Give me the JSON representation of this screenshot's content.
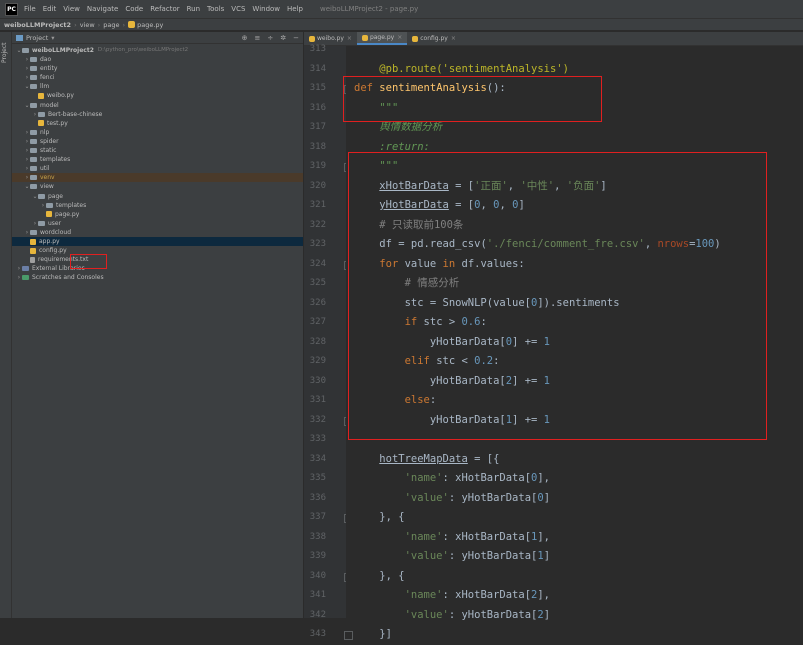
{
  "menubar": {
    "items": [
      "File",
      "Edit",
      "View",
      "Navigate",
      "Code",
      "Refactor",
      "Run",
      "Tools",
      "VCS",
      "Window",
      "Help"
    ],
    "window_title": "weiboLLMProject2 - page.py"
  },
  "breadcrumb": [
    "weiboLLMProject2",
    "view",
    "page",
    "page.py"
  ],
  "project_panel": {
    "title": "Project",
    "strip_label": "Project",
    "tree": [
      {
        "label": "weiboLLMProject2",
        "path": "D:\\python_pro\\weiboLLMProject2",
        "type": "folder",
        "depth": 0,
        "expanded": true,
        "bold": true
      },
      {
        "label": "dao",
        "type": "folder",
        "depth": 1,
        "expanded": false
      },
      {
        "label": "entity",
        "type": "folder",
        "depth": 1,
        "expanded": false
      },
      {
        "label": "fenci",
        "type": "folder",
        "depth": 1,
        "expanded": false
      },
      {
        "label": "llm",
        "type": "folder",
        "depth": 1,
        "expanded": true
      },
      {
        "label": "weibo.py",
        "type": "py",
        "depth": 2
      },
      {
        "label": "model",
        "type": "folder",
        "depth": 1,
        "expanded": true
      },
      {
        "label": "Bert-base-chinese",
        "type": "folder",
        "depth": 2,
        "expanded": false
      },
      {
        "label": "test.py",
        "type": "py",
        "depth": 2
      },
      {
        "label": "nlp",
        "type": "folder",
        "depth": 1,
        "expanded": false
      },
      {
        "label": "spider",
        "type": "folder",
        "depth": 1,
        "expanded": false
      },
      {
        "label": "static",
        "type": "folder",
        "depth": 1,
        "expanded": false
      },
      {
        "label": "templates",
        "type": "folder",
        "depth": 1,
        "expanded": false
      },
      {
        "label": "util",
        "type": "folder",
        "depth": 1,
        "expanded": false
      },
      {
        "label": "venv",
        "type": "folder",
        "depth": 1,
        "expanded": false,
        "venv": true
      },
      {
        "label": "view",
        "type": "folder",
        "depth": 1,
        "expanded": true
      },
      {
        "label": "page",
        "type": "folder",
        "depth": 2,
        "expanded": true
      },
      {
        "label": "templates",
        "type": "folder",
        "depth": 3,
        "expanded": false
      },
      {
        "label": "page.py",
        "type": "py",
        "depth": 3,
        "highlight": true
      },
      {
        "label": "user",
        "type": "folder",
        "depth": 2,
        "expanded": false
      },
      {
        "label": "wordcloud",
        "type": "folder",
        "depth": 1,
        "expanded": false
      },
      {
        "label": "app.py",
        "type": "py",
        "depth": 1,
        "selected": true
      },
      {
        "label": "config.py",
        "type": "py",
        "depth": 1
      },
      {
        "label": "requirements.txt",
        "type": "txt",
        "depth": 1
      },
      {
        "label": "External Libraries",
        "type": "libs",
        "depth": 0,
        "expanded": false
      },
      {
        "label": "Scratches and Consoles",
        "type": "scratch",
        "depth": 0,
        "expanded": false
      }
    ]
  },
  "editor_tabs": [
    {
      "label": "weibo.py",
      "active": false
    },
    {
      "label": "page.py",
      "active": true
    },
    {
      "label": "config.py",
      "active": false
    }
  ],
  "code": {
    "line_numbers": [
      "313",
      "314",
      "315",
      "316",
      "317",
      "318",
      "319",
      "320",
      "321",
      "322",
      "323",
      "324",
      "325",
      "326",
      "327",
      "328",
      "329",
      "330",
      "331",
      "332",
      "333",
      "334",
      "335",
      "336",
      "337",
      "338",
      "339",
      "340",
      "341",
      "342",
      "343"
    ],
    "lines": [
      [],
      [
        {
          "t": "    "
        },
        {
          "t": "@pb.route('sentimentAnalysis')",
          "c": "dec"
        }
      ],
      [
        {
          "t": "def ",
          "c": "kw"
        },
        {
          "t": "sentimentAnalysis",
          "c": "fn"
        },
        {
          "t": "():",
          "c": "var"
        }
      ],
      [
        {
          "t": "    "
        },
        {
          "t": "\"\"\"",
          "c": "doc"
        }
      ],
      [
        {
          "t": "    "
        },
        {
          "t": "舆情数据分析",
          "c": "doc"
        }
      ],
      [
        {
          "t": "    "
        },
        {
          "t": ":return:",
          "c": "doc"
        }
      ],
      [
        {
          "t": "    "
        },
        {
          "t": "\"\"\"",
          "c": "doc"
        }
      ],
      [
        {
          "t": "    "
        },
        {
          "t": "xHotBarData",
          "c": "uvar"
        },
        {
          "t": " = [",
          "c": "var"
        },
        {
          "t": "'正面'",
          "c": "str"
        },
        {
          "t": ", ",
          "c": "var"
        },
        {
          "t": "'中性'",
          "c": "str"
        },
        {
          "t": ", ",
          "c": "var"
        },
        {
          "t": "'负面'",
          "c": "str"
        },
        {
          "t": "]",
          "c": "var"
        }
      ],
      [
        {
          "t": "    "
        },
        {
          "t": "yHotBarData",
          "c": "uvar"
        },
        {
          "t": " = [",
          "c": "var"
        },
        {
          "t": "0",
          "c": "num"
        },
        {
          "t": ", ",
          "c": "var"
        },
        {
          "t": "0",
          "c": "num"
        },
        {
          "t": ", ",
          "c": "var"
        },
        {
          "t": "0",
          "c": "num"
        },
        {
          "t": "]",
          "c": "var"
        }
      ],
      [
        {
          "t": "    "
        },
        {
          "t": "# 只读取前100条",
          "c": "cmt"
        }
      ],
      [
        {
          "t": "    "
        },
        {
          "t": "df = pd.read_csv(",
          "c": "var"
        },
        {
          "t": "'./fenci/comment_fre.csv'",
          "c": "str"
        },
        {
          "t": ", ",
          "c": "var"
        },
        {
          "t": "nrows",
          "c": "param"
        },
        {
          "t": "=",
          "c": "var"
        },
        {
          "t": "100",
          "c": "num"
        },
        {
          "t": ")",
          "c": "var"
        }
      ],
      [
        {
          "t": "    "
        },
        {
          "t": "for ",
          "c": "kw"
        },
        {
          "t": "value ",
          "c": "var"
        },
        {
          "t": "in ",
          "c": "kw"
        },
        {
          "t": "df.values:",
          "c": "var"
        }
      ],
      [
        {
          "t": "        "
        },
        {
          "t": "# 情感分析",
          "c": "cmt"
        }
      ],
      [
        {
          "t": "        "
        },
        {
          "t": "stc = SnowNLP(value[",
          "c": "var"
        },
        {
          "t": "0",
          "c": "num"
        },
        {
          "t": "]).sentiments",
          "c": "var"
        }
      ],
      [
        {
          "t": "        "
        },
        {
          "t": "if ",
          "c": "kw"
        },
        {
          "t": "stc > ",
          "c": "var"
        },
        {
          "t": "0.6",
          "c": "num"
        },
        {
          "t": ":",
          "c": "var"
        }
      ],
      [
        {
          "t": "            "
        },
        {
          "t": "yHotBarData[",
          "c": "var"
        },
        {
          "t": "0",
          "c": "num"
        },
        {
          "t": "] += ",
          "c": "var"
        },
        {
          "t": "1",
          "c": "num"
        }
      ],
      [
        {
          "t": "        "
        },
        {
          "t": "elif ",
          "c": "kw"
        },
        {
          "t": "stc < ",
          "c": "var"
        },
        {
          "t": "0.2",
          "c": "num"
        },
        {
          "t": ":",
          "c": "var"
        }
      ],
      [
        {
          "t": "            "
        },
        {
          "t": "yHotBarData[",
          "c": "var"
        },
        {
          "t": "2",
          "c": "num"
        },
        {
          "t": "] += ",
          "c": "var"
        },
        {
          "t": "1",
          "c": "num"
        }
      ],
      [
        {
          "t": "        "
        },
        {
          "t": "else",
          "c": "kw"
        },
        {
          "t": ":",
          "c": "var"
        }
      ],
      [
        {
          "t": "            "
        },
        {
          "t": "yHotBarData[",
          "c": "var"
        },
        {
          "t": "1",
          "c": "num"
        },
        {
          "t": "] += ",
          "c": "var"
        },
        {
          "t": "1",
          "c": "num"
        }
      ],
      [],
      [
        {
          "t": "    "
        },
        {
          "t": "hotTreeMapData",
          "c": "uvar"
        },
        {
          "t": " = [{",
          "c": "var"
        }
      ],
      [
        {
          "t": "        "
        },
        {
          "t": "'name'",
          "c": "str"
        },
        {
          "t": ": xHotBarData[",
          "c": "var"
        },
        {
          "t": "0",
          "c": "num"
        },
        {
          "t": "],",
          "c": "var"
        }
      ],
      [
        {
          "t": "        "
        },
        {
          "t": "'value'",
          "c": "str"
        },
        {
          "t": ": yHotBarData[",
          "c": "var"
        },
        {
          "t": "0",
          "c": "num"
        },
        {
          "t": "]",
          "c": "var"
        }
      ],
      [
        {
          "t": "    "
        },
        {
          "t": "}, {",
          "c": "var"
        }
      ],
      [
        {
          "t": "        "
        },
        {
          "t": "'name'",
          "c": "str"
        },
        {
          "t": ": xHotBarData[",
          "c": "var"
        },
        {
          "t": "1",
          "c": "num"
        },
        {
          "t": "],",
          "c": "var"
        }
      ],
      [
        {
          "t": "        "
        },
        {
          "t": "'value'",
          "c": "str"
        },
        {
          "t": ": yHotBarData[",
          "c": "var"
        },
        {
          "t": "1",
          "c": "num"
        },
        {
          "t": "]",
          "c": "var"
        }
      ],
      [
        {
          "t": "    "
        },
        {
          "t": "}, {",
          "c": "var"
        }
      ],
      [
        {
          "t": "        "
        },
        {
          "t": "'name'",
          "c": "str"
        },
        {
          "t": ": xHotBarData[",
          "c": "var"
        },
        {
          "t": "2",
          "c": "num"
        },
        {
          "t": "],",
          "c": "var"
        }
      ],
      [
        {
          "t": "        "
        },
        {
          "t": "'value'",
          "c": "str"
        },
        {
          "t": ": yHotBarData[",
          "c": "var"
        },
        {
          "t": "2",
          "c": "num"
        },
        {
          "t": "]",
          "c": "var"
        }
      ],
      [
        {
          "t": "    "
        },
        {
          "t": "}]",
          "c": "var"
        }
      ]
    ]
  },
  "colors": {
    "editor_bg": "#2b2b2b",
    "annotation_red": "#e02020",
    "keyword": "#cc7832",
    "function": "#ffc66d",
    "string": "#6a8759",
    "number": "#6897bb"
  }
}
